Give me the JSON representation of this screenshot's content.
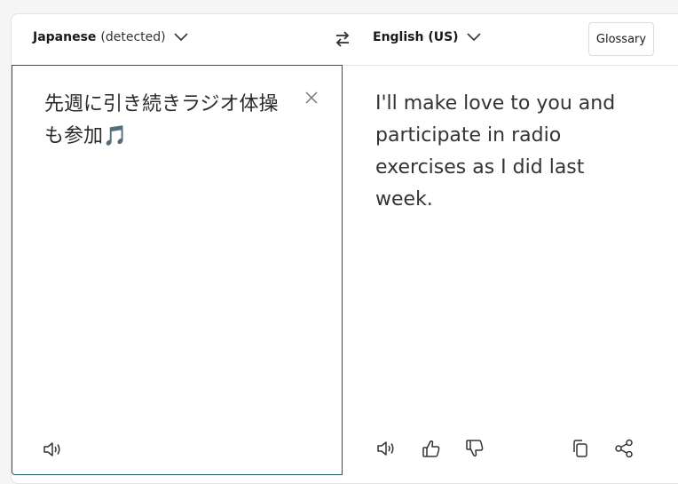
{
  "source": {
    "language": "Japanese",
    "detected_label": "(detected)",
    "text": "先週に引き続きラジオ体操も参加🎵"
  },
  "target": {
    "language": "English (US)",
    "text": "I'll make love to you and participate in radio exercises as I did last week."
  },
  "toolbar": {
    "glossary_label": "Glossary"
  },
  "icons": {
    "source_chevron": "chevron-down-icon",
    "swap": "swap-arrows-icon",
    "target_chevron": "chevron-down-icon",
    "clear": "close-icon",
    "source_listen": "speaker-icon",
    "target_listen": "speaker-icon",
    "thumbs_up": "thumbs-up-icon",
    "thumbs_down": "thumbs-down-icon",
    "copy": "copy-icon",
    "share": "share-icon"
  },
  "colors": {
    "active_border": "#1d5870",
    "text": "#333333"
  }
}
